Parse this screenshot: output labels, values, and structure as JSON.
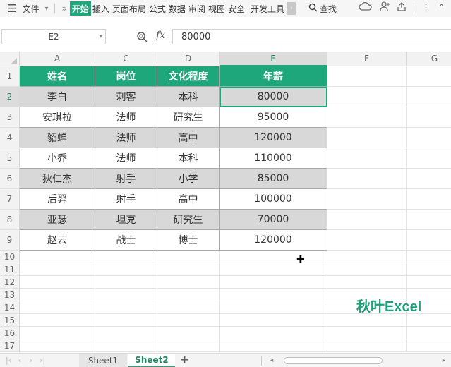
{
  "menubar": {
    "file_label": "文件",
    "tabs": [
      "开始",
      "插入",
      "页面布局",
      "公式",
      "数据",
      "审阅",
      "视图",
      "安全",
      "开发工具"
    ],
    "active_tab": 0,
    "search_label": "查找"
  },
  "formula_bar": {
    "cell_ref": "E2",
    "fx_label": "fx",
    "value": "80000"
  },
  "columns": [
    "A",
    "C",
    "D",
    "E",
    "F",
    "G"
  ],
  "selected_column": "E",
  "rows": [
    "1",
    "2",
    "3",
    "4",
    "5",
    "6",
    "7",
    "8",
    "9",
    "10",
    "11",
    "12",
    "13",
    "14",
    "15",
    "16",
    "17"
  ],
  "selected_row": "2",
  "table": {
    "headers": [
      "姓名",
      "岗位",
      "文化程度",
      "年薪"
    ],
    "data": [
      [
        "李白",
        "刺客",
        "本科",
        "80000"
      ],
      [
        "安琪拉",
        "法师",
        "研究生",
        "95000"
      ],
      [
        "貂蝉",
        "法师",
        "高中",
        "120000"
      ],
      [
        "小乔",
        "法师",
        "本科",
        "110000"
      ],
      [
        "狄仁杰",
        "射手",
        "小学",
        "85000"
      ],
      [
        "后羿",
        "射手",
        "高中",
        "100000"
      ],
      [
        "亚瑟",
        "坦克",
        "研究生",
        "70000"
      ],
      [
        "赵云",
        "战士",
        "博士",
        "120000"
      ]
    ],
    "header_color": "#1ea77a",
    "banding_color": "#d8d8d8"
  },
  "watermark": "秋叶Excel",
  "sheets": [
    "Sheet1",
    "Sheet2"
  ],
  "active_sheet": "Sheet2",
  "colors": {
    "accent": "#1ea77a"
  }
}
